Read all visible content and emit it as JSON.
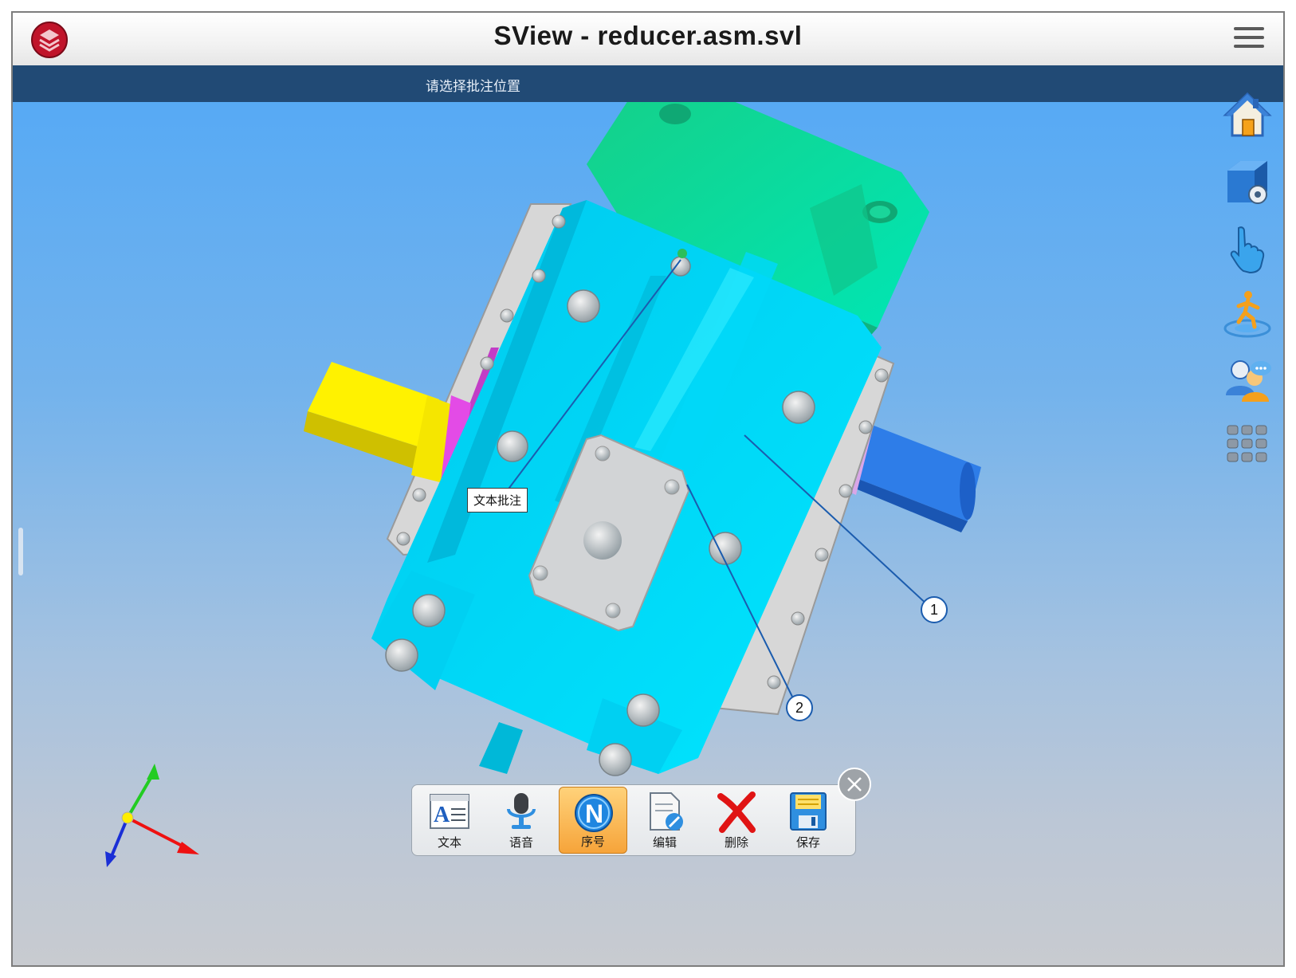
{
  "app": {
    "title": "SView - reducer.asm.svl"
  },
  "hint": {
    "text": "请选择批注位置"
  },
  "side_toolbar": {
    "items": [
      {
        "name": "home-icon"
      },
      {
        "name": "view-settings-icon"
      },
      {
        "name": "gesture-icon"
      },
      {
        "name": "walkthrough-icon"
      },
      {
        "name": "collaboration-icon"
      },
      {
        "name": "apps-grid-icon"
      }
    ]
  },
  "annotations": {
    "text_callout": "文本批注",
    "balloons": [
      {
        "number": "1"
      },
      {
        "number": "2"
      }
    ]
  },
  "annotation_toolbar": {
    "items": [
      {
        "label": "文本",
        "icon": "text-annotation-icon"
      },
      {
        "label": "语音",
        "icon": "microphone-icon"
      },
      {
        "label": "序号",
        "icon": "sequence-number-icon",
        "active": true
      },
      {
        "label": "编辑",
        "icon": "edit-document-icon"
      },
      {
        "label": "删除",
        "icon": "delete-x-icon"
      },
      {
        "label": "保存",
        "icon": "save-floppy-icon"
      }
    ]
  },
  "colors": {
    "hint_bar": "#214a75",
    "housing": "#00e2ff",
    "cover": "#05e3a8",
    "input_shaft": "#ffee00",
    "output_shaft": "#1f6fe0",
    "active_tool": "#f6a43a"
  }
}
